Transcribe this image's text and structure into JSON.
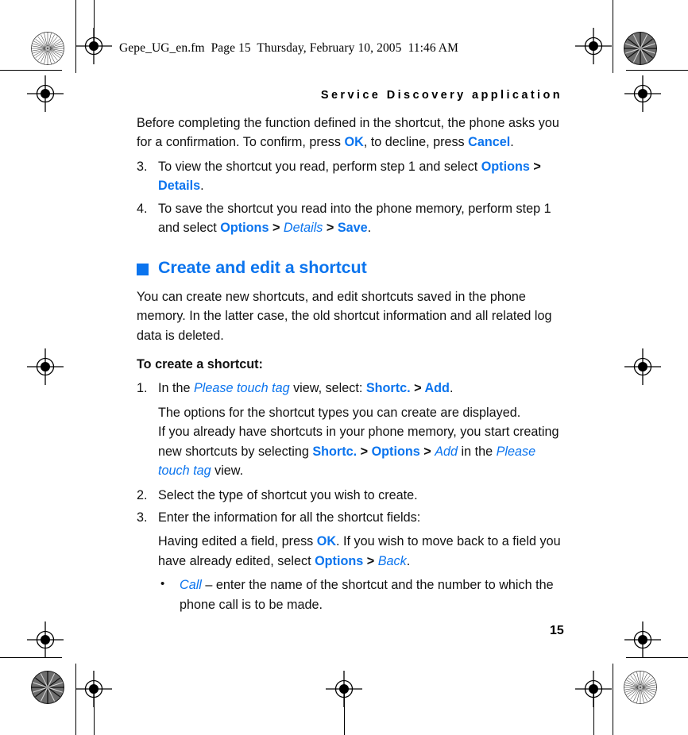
{
  "file_info": "Gepe_UG_en.fm  Page 15  Thursday, February 10, 2005  11:46 AM",
  "running_head": "Service Discovery application",
  "page_number": "15",
  "accent_color": "#0B74EE",
  "body": {
    "intro_paragraph": {
      "t1": "Before completing the function defined in the shortcut, the phone asks you for a confirmation. To confirm, press ",
      "ui1": "OK",
      "t2": ", to decline, press ",
      "ui2": "Cancel",
      "t3": "."
    },
    "step3": {
      "num": "3.",
      "t1": "To view the shortcut you read, perform step 1 and select ",
      "ui1": "Options",
      "sep1": " > ",
      "ui2": "Details",
      "t2": "."
    },
    "step4": {
      "num": "4.",
      "t1": "To save the shortcut you read into the phone memory, perform step 1 and select ",
      "ui1": "Options",
      "sep1": " > ",
      "uii1": "Details",
      "sep2": " > ",
      "ui2": "Save",
      "t2": "."
    },
    "heading": "Create and edit a shortcut",
    "overview": "You can create new shortcuts, and edit shortcuts saved in the phone memory. In the latter case, the old shortcut information and all related log data is deleted.",
    "lead_in": "To create a shortcut:",
    "create_step1": {
      "num": "1.",
      "t1": "In the ",
      "uii1": "Please touch tag",
      "t2": " view, select: ",
      "ui1": "Shortc.",
      "sep1": " > ",
      "ui2": "Add",
      "t3": "."
    },
    "create_step1_note": {
      "t1": "The options for the shortcut types you can create are displayed.",
      "t2": "If you already have shortcuts in your phone memory, you start creating new shortcuts by selecting ",
      "ui1": "Shortc.",
      "sep1": " > ",
      "ui2": "Options",
      "sep2": " > ",
      "uii1": "Add",
      "t3": " in the ",
      "uii2": "Please touch tag",
      "t4": " view."
    },
    "create_step2": {
      "num": "2.",
      "t1": "Select the type of shortcut you wish to create."
    },
    "create_step3": {
      "num": "3.",
      "t1": "Enter the information for all the shortcut fields:"
    },
    "create_step3_note": {
      "t1": "Having edited a field, press ",
      "ui1": "OK",
      "t2": ". If you wish to move back to a field you have already edited, select ",
      "ui2": "Options",
      "sep1": " > ",
      "uii1": "Back",
      "t3": "."
    },
    "bullet_call": {
      "dot": "•",
      "uii1": "Call",
      "t1": " – enter the name of the shortcut and the number to which the phone call is to be made."
    }
  }
}
